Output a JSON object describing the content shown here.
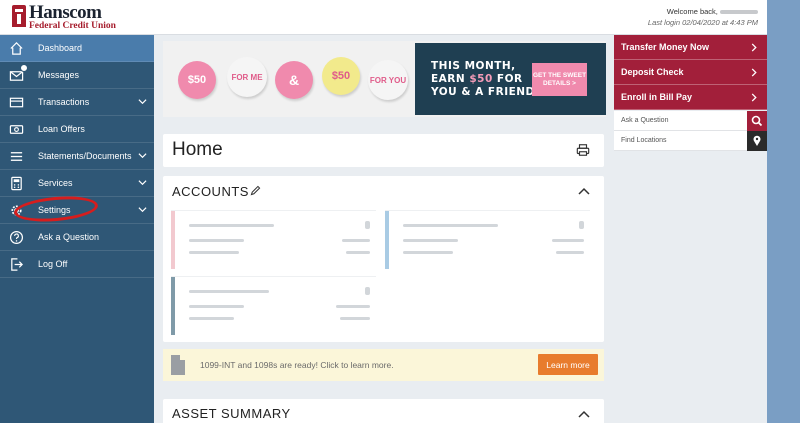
{
  "header": {
    "logo_name": "Hanscom",
    "logo_sub": "Federal Credit Union",
    "welcome": "Welcome back,",
    "last_login": "Last login 02/04/2020 at 4:43 PM"
  },
  "sidebar": {
    "items": [
      {
        "label": "Dashboard",
        "icon": "home-icon"
      },
      {
        "label": "Messages",
        "icon": "envelope-icon"
      },
      {
        "label": "Transactions",
        "icon": "card-icon"
      },
      {
        "label": "Loan Offers",
        "icon": "money-icon"
      },
      {
        "label": "Statements/Documents",
        "icon": "list-icon"
      },
      {
        "label": "Services",
        "icon": "calculator-icon"
      },
      {
        "label": "Settings",
        "icon": "gear-icon"
      },
      {
        "label": "Ask a Question",
        "icon": "question-icon"
      },
      {
        "label": "Log Off",
        "icon": "logout-icon"
      }
    ]
  },
  "banner": {
    "hearts": [
      "$50",
      "FOR ME",
      "&",
      "$50",
      "FOR YOU"
    ],
    "line1": "THIS MONTH,",
    "line2_a": "EARN ",
    "line2_b": "$50",
    "line2_c": " FOR",
    "line3": "YOU & A FRIEND",
    "button": "GET THE SWEET DETAILS >",
    "colors": {
      "pink": "#f08aad",
      "navy": "#1f3f52",
      "yellow": "#f2ea8c"
    }
  },
  "home": {
    "title": "Home"
  },
  "accounts": {
    "title": "ACCOUNTS"
  },
  "notice": {
    "text": "1099-INT and 1098s are ready! Click to learn more.",
    "button": "Learn more"
  },
  "asset_summary": {
    "title": "ASSET SUMMARY"
  },
  "quick_actions": [
    {
      "label": "Transfer Money Now"
    },
    {
      "label": "Deposit Check"
    },
    {
      "label": "Enroll in Bill Pay"
    }
  ],
  "side_links": [
    {
      "label": "Ask a Question",
      "icon": "search-icon"
    },
    {
      "label": "Find Locations",
      "icon": "location-pin-icon"
    }
  ],
  "colors": {
    "sidebar": "#2f5776",
    "active": "#4a7cab",
    "brand_red": "#a21f3a",
    "accent_orange": "#e87c2d"
  }
}
